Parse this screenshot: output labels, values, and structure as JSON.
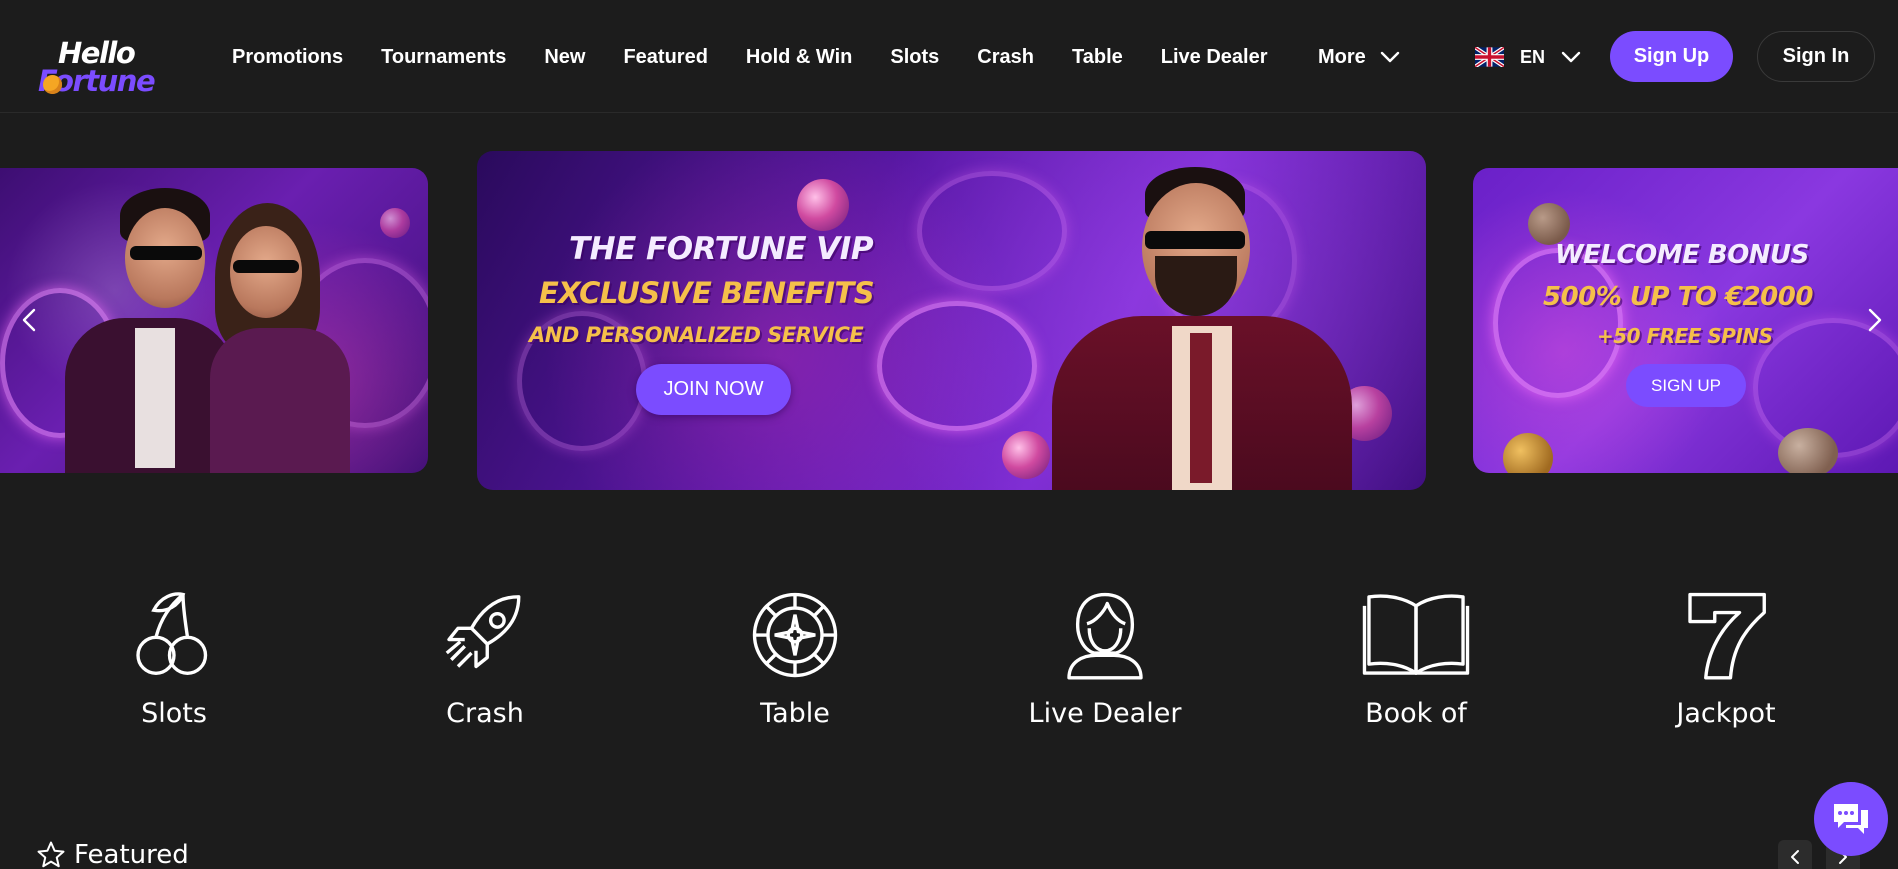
{
  "brand": {
    "logo_line1": "Hello",
    "logo_line2": "Fortune",
    "accent": "#7b4cff",
    "background": "#1c1c1c",
    "highlight_yellow": "#f5c04a"
  },
  "nav": {
    "items": [
      {
        "label": "Promotions"
      },
      {
        "label": "Tournaments"
      },
      {
        "label": "New"
      },
      {
        "label": "Featured"
      },
      {
        "label": "Hold & Win"
      },
      {
        "label": "Slots"
      },
      {
        "label": "Crash"
      },
      {
        "label": "Table"
      },
      {
        "label": "Live Dealer"
      }
    ],
    "more_label": "More",
    "more_icon": "chevron-down-icon"
  },
  "language": {
    "flag_icon": "uk-flag-icon",
    "code": "EN"
  },
  "auth": {
    "signup_label": "Sign Up",
    "signin_label": "Sign In"
  },
  "banners": {
    "main": {
      "line1": "THE FORTUNE VIP",
      "line2": "EXCLUSIVE BENEFITS",
      "line3": "AND PERSONALIZED SERVICE",
      "button": "JOIN NOW"
    },
    "right": {
      "line1": "WELCOME BONUS",
      "line2": "500% UP TO €2000",
      "line3": "+50 FREE SPINS",
      "button": "SIGN UP"
    },
    "prev_icon": "chevron-left-icon",
    "next_icon": "chevron-right-icon"
  },
  "categories": [
    {
      "label": "Slots",
      "icon": "cherries-icon"
    },
    {
      "label": "Crash",
      "icon": "rocket-icon"
    },
    {
      "label": "Table",
      "icon": "roulette-icon"
    },
    {
      "label": "Live Dealer",
      "icon": "dealer-icon"
    },
    {
      "label": "Book of",
      "icon": "book-icon"
    },
    {
      "label": "Jackpot",
      "icon": "seven-icon"
    }
  ],
  "featured": {
    "label": "Featured",
    "icon": "star-icon"
  },
  "chat": {
    "icon": "chat-icon"
  }
}
